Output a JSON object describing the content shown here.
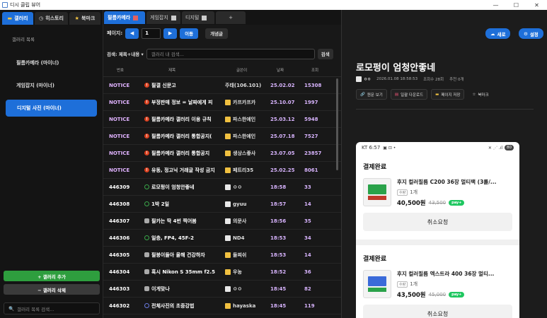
{
  "window": {
    "title": "디시 클립 뷰어",
    "controls": [
      "—",
      "☐",
      "✕"
    ]
  },
  "sidebar": {
    "tabs": [
      {
        "icon": "folder-icon",
        "label": "갤러리"
      },
      {
        "icon": "clock-icon",
        "label": "히스토리"
      },
      {
        "icon": "star-icon",
        "label": "북마크"
      }
    ],
    "heading": "갤러리 목록",
    "galleries": [
      "필름카메라 (마이너)",
      "게임잡지 (마이너)",
      "디지털 사진 (마이너)"
    ],
    "add_label": "+ 갤러리 추가",
    "remove_label": "− 갤러리 삭제",
    "search_placeholder": "갤러리 목록 검색..."
  },
  "main": {
    "tabs": [
      "필름카메라",
      "게임잡지",
      "디지털"
    ],
    "new_tab": "+",
    "pager": {
      "label": "페이지:",
      "prev": "◀",
      "page": "1",
      "next": "▶",
      "go": "이동",
      "concept": "개념글"
    },
    "search": {
      "mode": "검색: 제목+내용",
      "placeholder": "갤러리 내 검색...",
      "button": "검색"
    },
    "headers": [
      "번호",
      "제목",
      "글쓴이",
      "날짜",
      "조회"
    ],
    "rows": [
      {
        "no": "NOTICE",
        "icon": "red",
        "title": "필갤 신문고",
        "user": "주태(106.101)",
        "uicon": "none",
        "date": "25.02.02",
        "views": "15308"
      },
      {
        "no": "NOTICE",
        "icon": "red",
        "title": "부정판매 정보 = 날짜에게 피",
        "user": "카프카프카",
        "uicon": "yellow",
        "date": "25.10.07",
        "views": "1997"
      },
      {
        "no": "NOTICE",
        "icon": "red",
        "title": "필름카메라 갤러리 이용 규칙",
        "user": "파스한예인",
        "uicon": "yellow",
        "date": "25.03.12",
        "views": "5948"
      },
      {
        "no": "NOTICE",
        "icon": "red",
        "title": "필름카메라 갤러리 통합공지(",
        "user": "파스한예인",
        "uicon": "yellow",
        "date": "25.07.18",
        "views": "7527"
      },
      {
        "no": "NOTICE",
        "icon": "red",
        "title": "필름카메라 갤러리 통합공지",
        "user": "생상스좋사",
        "uicon": "yellow",
        "date": "23.07.05",
        "views": "23857"
      },
      {
        "no": "NOTICE",
        "icon": "red",
        "title": "유동, 정고닉 거래글 작성 금지",
        "user": "페트리35",
        "uicon": "yellow",
        "date": "25.02.25",
        "views": "8061"
      },
      {
        "no": "446309",
        "icon": "ring",
        "title": "로모펑이 엄청안좋네",
        "user": "ㅇㅇ",
        "uicon": "white",
        "date": "18:58",
        "views": "33"
      },
      {
        "no": "446308",
        "icon": "ring",
        "title": "1박 2일",
        "user": "gyuu",
        "uicon": "white",
        "date": "18:57",
        "views": "14"
      },
      {
        "no": "446307",
        "icon": "chat",
        "title": "필카는 딱 4번 찍어봄",
        "user": "의문사",
        "uicon": "white",
        "date": "18:56",
        "views": "35"
      },
      {
        "no": "446306",
        "icon": "ring",
        "title": "일층, FP4, 45F-2",
        "user": "ND4",
        "uicon": "white",
        "date": "18:53",
        "views": "34"
      },
      {
        "no": "446305",
        "icon": "chat",
        "title": "필붕이들아 올해 건강하자",
        "user": "들찌쉬",
        "uicon": "yellow",
        "date": "18:53",
        "views": "14"
      },
      {
        "no": "446304",
        "icon": "chat",
        "title": "혹시 Nikon S 35mm f2.5",
        "user": "우농",
        "uicon": "yellow",
        "date": "18:52",
        "views": "36"
      },
      {
        "no": "446303",
        "icon": "chat",
        "title": "이게맞나",
        "user": "ㅇㅇ",
        "uicon": "white",
        "date": "18:45",
        "views": "82"
      },
      {
        "no": "446302",
        "icon": "ringb",
        "title": "전체사진의 초중강법",
        "user": "hayaska",
        "uicon": "yellow",
        "date": "18:45",
        "views": "119"
      }
    ]
  },
  "detail": {
    "refresh_label": "새로",
    "settings_label": "설정",
    "title": "로모펑이 엄청안좋네",
    "author": "ㅇㅇ",
    "date": "2026.01.08 18:58:53",
    "views": "조회수 28회",
    "recommend": "추천 0개",
    "actions": [
      "원문 보기",
      "일괄 다운로드",
      "페이지 저장",
      "북마크"
    ],
    "phone": {
      "time": "KT 6:57",
      "battery": "80",
      "orders": [
        {
          "status": "결제완료",
          "name": "후지 컬러필름 C200 36장 멀티팩 (3롤/...",
          "qty_tag": "수량",
          "qty": "1개",
          "price": "40,500원",
          "old_price": "43,500",
          "pay": "pay+",
          "cancel": "취소요청"
        },
        {
          "status": "결제완료",
          "name": "후지 컬러필름 엑스트라 400 36장 멀티...",
          "qty_tag": "수량",
          "qty": "1개",
          "price": "43,500원",
          "old_price": "45,000",
          "pay": "pay+",
          "cancel": "취소요청"
        }
      ]
    }
  }
}
